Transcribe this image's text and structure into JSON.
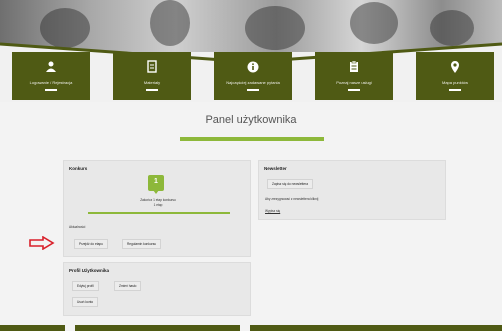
{
  "nav": {
    "items": [
      {
        "label": "Logowanie / Rejestracja",
        "icon": "users-icon"
      },
      {
        "label": "Materiały",
        "icon": "document-icon"
      },
      {
        "label": "Najczęściej zadawane pytania",
        "icon": "info-icon"
      },
      {
        "label": "Poznaj nasze usługi",
        "icon": "clipboard-icon"
      },
      {
        "label": "Mapa punktów",
        "icon": "map-pin-icon"
      }
    ]
  },
  "page": {
    "title": "Panel użytkownika"
  },
  "konkurs": {
    "heading": "Konkurs",
    "pin_label": "1",
    "message_line1": "Zakończ 1 etap konkursu",
    "message_line2": "1 etap",
    "note": "Aktualności",
    "btn_primary": "Przejdź do etapu",
    "btn_secondary": "Regulamin konkursu"
  },
  "newsletter": {
    "heading": "Newsletter",
    "btn_subscribe": "Zapisz się do newslettera",
    "text": "Aby zrezygnować z newslettera kliknij",
    "link": "Wypisz się"
  },
  "profil": {
    "heading": "Profil Użytkownika",
    "btn_edit": "Edytuj profil",
    "btn_password": "Zmień hasło",
    "btn_delete": "Usuń konto"
  },
  "colors": {
    "brand": "#4f5a14",
    "accent": "#8db83a",
    "arrow": "#d9202a"
  }
}
